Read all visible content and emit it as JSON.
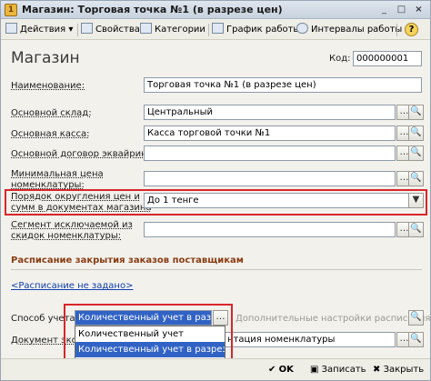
{
  "window": {
    "title": "Магазин: Торговая точка №1 (в разрезе цен)",
    "buttons": [
      "_",
      "□",
      "×"
    ]
  },
  "toolbar": {
    "actions_label": "Действия",
    "properties_label": "Свойства",
    "categories_label": "Категории",
    "schedule_label": "График работы",
    "intervals_label": "Интервалы работы",
    "help_label": "?"
  },
  "form": {
    "heading": "Магазин",
    "code_label": "Код:",
    "code_value": "000000001",
    "name_label": "Наименование:",
    "name_value": "Торговая точка №1 (в разрезе цен)",
    "warehouse_label": "Основной склад:",
    "warehouse_value": "Центральный",
    "cashbox_label": "Основная касса:",
    "cashbox_value": "Касса торговой точки №1",
    "acquiring_label": "Основной договор эквайринга:",
    "acquiring_value": "",
    "minprice_label_1": "Минимальная цена",
    "minprice_label_2": "номенклатуры:",
    "minprice_value": "",
    "rounding_label_1": "Порядок округления цен и",
    "rounding_label_2": "сумм в документах магазина",
    "rounding_value": "До 1 тенге",
    "segment_label_1": "Сегмент исключаемой из",
    "segment_label_2": "скидок номенклатуры:",
    "segment_value": "",
    "group_title": "Расписание закрытия заказов поставщикам",
    "schedule_link": "<Расписание не задано>",
    "method_label": "Способ учета:",
    "method_value": "Количественный учет в разрезе ...",
    "extra_settings": "Дополнительные настройки расписания",
    "document_label_start": "Документ экс",
    "document_value_tail": "нтация номенклатуры"
  },
  "dropdown": {
    "items": [
      "Количественный учет",
      "Количественный учет в разрезе..."
    ],
    "selected_index": 1
  },
  "bottombar": {
    "ok_label": "OK",
    "save_label": "Записать",
    "close_label": "Закрыть"
  },
  "colors": {
    "highlight_border": "#d9262b",
    "selection": "#3163c5",
    "group_title": "#8a3c12",
    "link": "#1040b0"
  }
}
